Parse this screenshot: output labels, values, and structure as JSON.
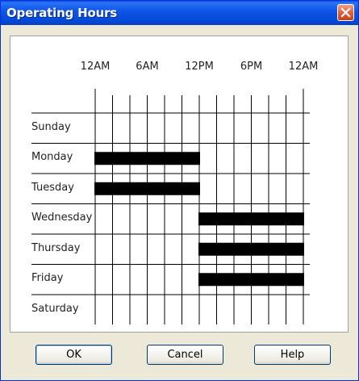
{
  "window": {
    "title": "Operating Hours",
    "close_icon": "close-icon"
  },
  "schedule": {
    "time_labels": [
      "12AM",
      "6AM",
      "12PM",
      "6PM",
      "12AM"
    ],
    "days": [
      {
        "label": "Sunday",
        "blocks": []
      },
      {
        "label": "Monday",
        "blocks": [
          [
            0,
            12
          ]
        ]
      },
      {
        "label": "Tuesday",
        "blocks": [
          [
            0,
            12
          ]
        ]
      },
      {
        "label": "Wednesday",
        "blocks": [
          [
            12,
            24
          ]
        ]
      },
      {
        "label": "Thursday",
        "blocks": [
          [
            12,
            24
          ]
        ]
      },
      {
        "label": "Friday",
        "blocks": [
          [
            12,
            24
          ]
        ]
      },
      {
        "label": "Saturday",
        "blocks": []
      }
    ],
    "block_color": "#000000"
  },
  "buttons": {
    "ok": "OK",
    "cancel": "Cancel",
    "help": "Help"
  }
}
